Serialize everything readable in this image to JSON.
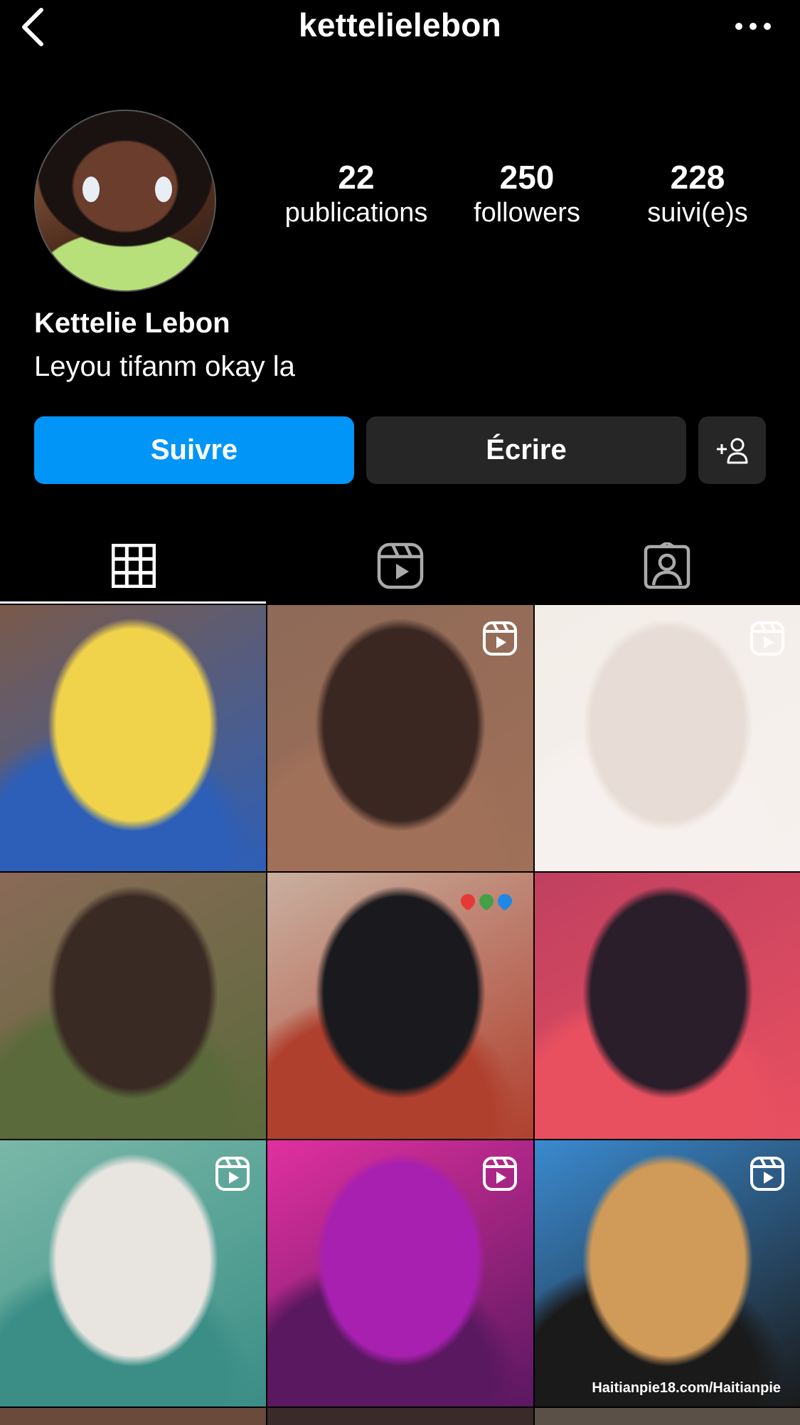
{
  "header": {
    "username": "kettelielebon"
  },
  "profile": {
    "stats": [
      {
        "value": "22",
        "label": "publications"
      },
      {
        "value": "250",
        "label": "followers"
      },
      {
        "value": "228",
        "label": "suivi(e)s"
      }
    ],
    "name": "Kettelie Lebon",
    "bio": "Leyou tifanm okay la"
  },
  "actions": {
    "follow_label": "Suivre",
    "message_label": "Écrire"
  },
  "tabs": [
    {
      "icon": "grid-icon",
      "active": true
    },
    {
      "icon": "reels-icon",
      "active": false
    },
    {
      "icon": "tagged-icon",
      "active": false
    }
  ],
  "grid": {
    "tiles": [
      {
        "reel": false,
        "bg": [
          "#7a5a4a",
          "#f0d34a",
          "#2d5fb8"
        ]
      },
      {
        "reel": true,
        "bg": [
          "#8e6a58",
          "#3a2722",
          "#a07058"
        ]
      },
      {
        "reel": true,
        "bg": [
          "#f3ede8",
          "#e8ddd6",
          "#f6f1ee"
        ]
      },
      {
        "reel": false,
        "bg": [
          "#8a6a58",
          "#3a2a24",
          "#5a6a3a"
        ]
      },
      {
        "reel": false,
        "bg": [
          "#c8b0a0",
          "#1a1a1e",
          "#b0402e"
        ]
      },
      {
        "reel": false,
        "bg": [
          "#c04060",
          "#2a1e2a",
          "#e85060"
        ]
      },
      {
        "reel": true,
        "bg": [
          "#7ab8a8",
          "#e8e4e0",
          "#3a8e86"
        ]
      },
      {
        "reel": true,
        "bg": [
          "#e030a0",
          "#a820b0",
          "#5a1860"
        ]
      },
      {
        "reel": true,
        "bg": [
          "#3a8ad0",
          "#d09a58",
          "#1a1a1a"
        ]
      }
    ],
    "watermark": "Haitianpie18.com/Haitianpie",
    "emoji": [
      "#e53935",
      "#43a047",
      "#1e88e5"
    ]
  },
  "colors": {
    "accent": "#0095f6",
    "button_dark": "#262626",
    "background": "#000000"
  }
}
